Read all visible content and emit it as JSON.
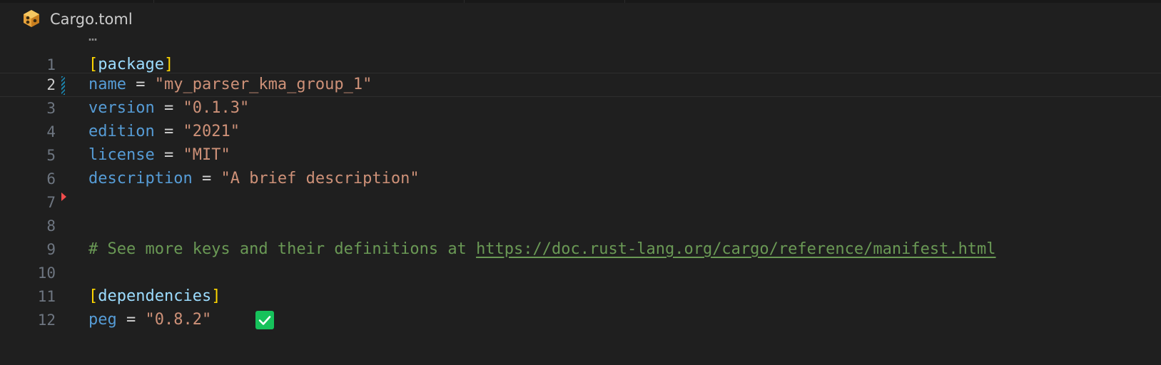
{
  "breadcrumb": {
    "file_name": "Cargo.toml",
    "file_icon": "rust-crate-icon"
  },
  "editor": {
    "folded_indicator": "…",
    "active_line": 2,
    "lines": [
      {
        "number": "1",
        "bracket_open": "[",
        "table": "package",
        "bracket_close": "]"
      },
      {
        "number": "2",
        "key": "name",
        "op": " = ",
        "value": "\"my_parser_kma_group_1\""
      },
      {
        "number": "3",
        "key": "version",
        "op": " = ",
        "value": "\"0.1.3\""
      },
      {
        "number": "4",
        "key": "edition",
        "op": " = ",
        "value": "\"2021\""
      },
      {
        "number": "5",
        "key": "license",
        "op": " = ",
        "value": "\"MIT\""
      },
      {
        "number": "6",
        "key": "description",
        "op": " = ",
        "value": "\"A brief description\""
      },
      {
        "number": "7"
      },
      {
        "number": "8"
      },
      {
        "number": "9",
        "comment": "# See more keys and their definitions at ",
        "link": "https://doc.rust-lang.org/cargo/reference/manifest.html"
      },
      {
        "number": "10"
      },
      {
        "number": "11",
        "bracket_open": "[",
        "table": "dependencies",
        "bracket_close": "]"
      },
      {
        "number": "12",
        "key": "peg",
        "op": " = ",
        "value": "\"0.8.2\"",
        "status_icon": "check-icon"
      }
    ]
  },
  "colors": {
    "background": "#1f1f1f",
    "key": "#569cd6",
    "string": "#ce9178",
    "comment": "#6a9955",
    "bracket": "#ffd700",
    "table_name": "#9cdcfe",
    "line_number": "#6e7681",
    "active_line_number": "#cccccc",
    "check_badge": "#16c25b",
    "modified_marker": "#1b81a8",
    "error_marker": "#f14c4c"
  }
}
